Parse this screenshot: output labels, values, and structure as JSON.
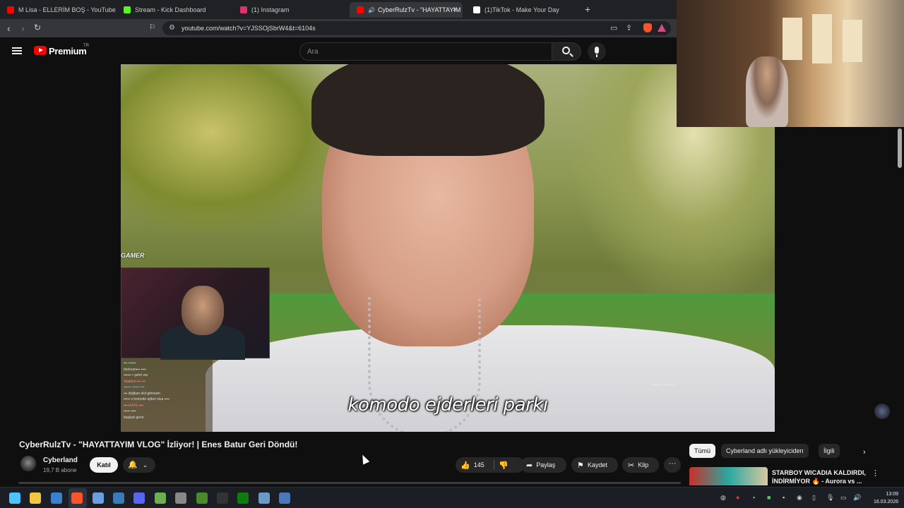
{
  "browser": {
    "tabs": [
      {
        "label": "M Lisa - ELLERİM BOŞ - YouTube",
        "color": "#ff0000"
      },
      {
        "label": "Stream - Kick Dashboard",
        "color": "#53fc18"
      },
      {
        "label": "(1) Instagram",
        "color": "#e1306c"
      },
      {
        "label": "CyberRulzTv - \"HAYATTAYIM",
        "color": "#ff0000",
        "active": true
      },
      {
        "label": "(1)TikTok - Make Your Day",
        "color": "#ffffff"
      }
    ],
    "new_tab": "+",
    "close_tab": "×",
    "url": "youtube.com/watch?v=YJSSOjSbrW4&t=6104s"
  },
  "yt_header": {
    "logo_text": "Premium",
    "region": "TR",
    "search_placeholder": "Ara"
  },
  "video": {
    "subtitle": "komodo ejderleri parkı",
    "overlay_logo": "GAMER",
    "chat_lines": [
      "▪▪▪ ▪▪▪▪▪▪",
      "berkcan▪▪▪ ▪▪▪▪",
      "▪▪▪▪▪▪ ▪ şehri var",
      "ölüdünn ▪▪▪ ▪▪▪",
      "▪▪▪▪▪▪ ▪▪▪▪▪▪ ▪▪▪",
      "▪▪▪ doğkan ekli gitmesin",
      "▪▪▪▪▪ o komodo ejderi olsa ▪▪▪▪",
      "▪▪▪▪▪1141 ▪▪▪▪",
      "▪▪▪▪▪ ▪▪▪▪",
      "başladı gene"
    ],
    "title": "CyberRulzTv - \"HAYATTAYIM VLOG\" İzliyor! | Enes Batur Geri Döndü!"
  },
  "channel": {
    "name": "Cyberland",
    "subscribers": "19,7 B abone",
    "join_label": "Katıl"
  },
  "actions": {
    "likes": "145",
    "share": "Paylaş",
    "save": "Kaydet",
    "clip": "Klip",
    "more": "···"
  },
  "related": {
    "chips": [
      "Tümü",
      "Cyberland adlı yükleyiciden",
      "İlgili"
    ],
    "first_item_title": "STARBOY WICADIA KALDIRDI, İNDİRMİYOR 🔥 - Aurora vs ..."
  },
  "taskbar": {
    "time": "13:09",
    "date": "16.03.2026",
    "icons": [
      {
        "name": "windows-start-icon",
        "color": "#4cc2ff"
      },
      {
        "name": "file-explorer-icon",
        "color": "#f4c542"
      },
      {
        "name": "app-icon",
        "color": "#3b7fd1"
      },
      {
        "name": "brave-icon",
        "color": "#fb542b"
      },
      {
        "name": "app-icon-2",
        "color": "#6aa0e0"
      },
      {
        "name": "steam-icon",
        "color": "#3a7ab8"
      },
      {
        "name": "discord-icon",
        "color": "#5865f2"
      },
      {
        "name": "app-icon-3",
        "color": "#6ab04c"
      },
      {
        "name": "app-icon-4",
        "color": "#888888"
      },
      {
        "name": "minecraft-icon",
        "color": "#4a8a2a"
      },
      {
        "name": "epic-games-icon",
        "color": "#333333"
      },
      {
        "name": "xbox-icon",
        "color": "#107c10"
      },
      {
        "name": "app-icon-5",
        "color": "#6a9ac8"
      },
      {
        "name": "app-icon-6",
        "color": "#4a78b8"
      }
    ]
  }
}
